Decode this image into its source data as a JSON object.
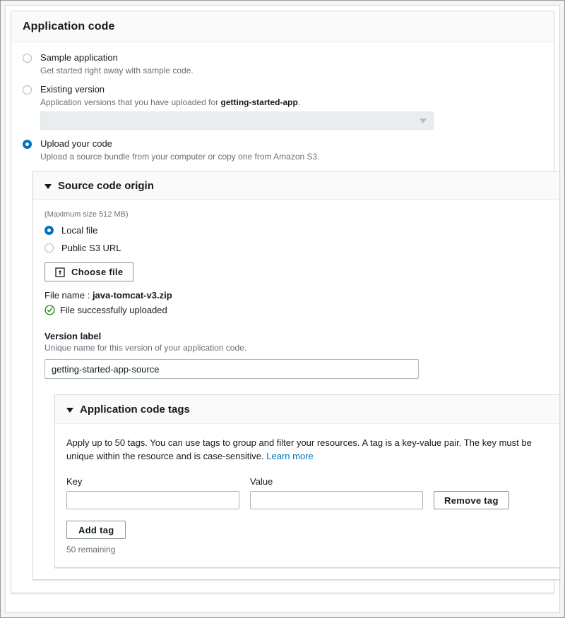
{
  "panel": {
    "title": "Application code"
  },
  "code_options": [
    {
      "id": "sample-application",
      "label": "Sample application",
      "description": "Get started right away with sample code.",
      "selected": false
    },
    {
      "id": "existing-version",
      "label": "Existing version",
      "description_prefix": "Application versions that you have uploaded for ",
      "description_strong": "getting-started-app",
      "description_suffix": ".",
      "selected": false
    },
    {
      "id": "upload-your-code",
      "label": "Upload your code",
      "description": "Upload a source bundle from your computer or copy one from Amazon S3.",
      "selected": true
    }
  ],
  "existing_version_select": {
    "value": "",
    "placeholder": "",
    "disabled": true,
    "caret_icon": "chevron-down-icon"
  },
  "source_code_origin": {
    "title": "Source code origin",
    "expanded": true,
    "toggle_icon": "triangle-down-icon",
    "max_size_note": "(Maximum size 512 MB)",
    "origin_options": [
      {
        "id": "local-file",
        "label": "Local file",
        "selected": true
      },
      {
        "id": "public-s3-url",
        "label": "Public S3 URL",
        "selected": false
      }
    ],
    "choose_file_button": {
      "label": "Choose file",
      "icon": "upload-icon"
    },
    "file_name_label": "File name :",
    "file_name_value": "java-tomcat-v3.zip",
    "upload_status": {
      "icon": "check-circle-icon",
      "text": "File successfully uploaded",
      "color": "#1d8102"
    },
    "version_label_field": {
      "label": "Version label",
      "hint": "Unique name for this version of your application code.",
      "value": "getting-started-app-source",
      "placeholder": ""
    }
  },
  "application_code_tags": {
    "title": "Application code tags",
    "expanded": true,
    "toggle_icon": "triangle-down-icon",
    "description": "Apply up to 50 tags. You can use tags to group and filter your resources. A tag is a key-value pair. The key must be unique within the resource and is case-sensitive. ",
    "learn_more_label": "Learn more",
    "columns": {
      "key": "Key",
      "value": "Value"
    },
    "rows": [
      {
        "key": "",
        "value": "",
        "key_placeholder": "",
        "value_placeholder": "",
        "remove_label": "Remove tag"
      }
    ],
    "add_tag_label": "Add tag",
    "remaining_text": "50 remaining"
  },
  "colors": {
    "accent": "#0073bb",
    "link": "#0073bb",
    "success": "#1d8102",
    "text": "#16191f",
    "muted": "#687078",
    "border": "#d5dbdb",
    "header_bg": "#fafafa",
    "disabled_bg": "#eaedee"
  }
}
